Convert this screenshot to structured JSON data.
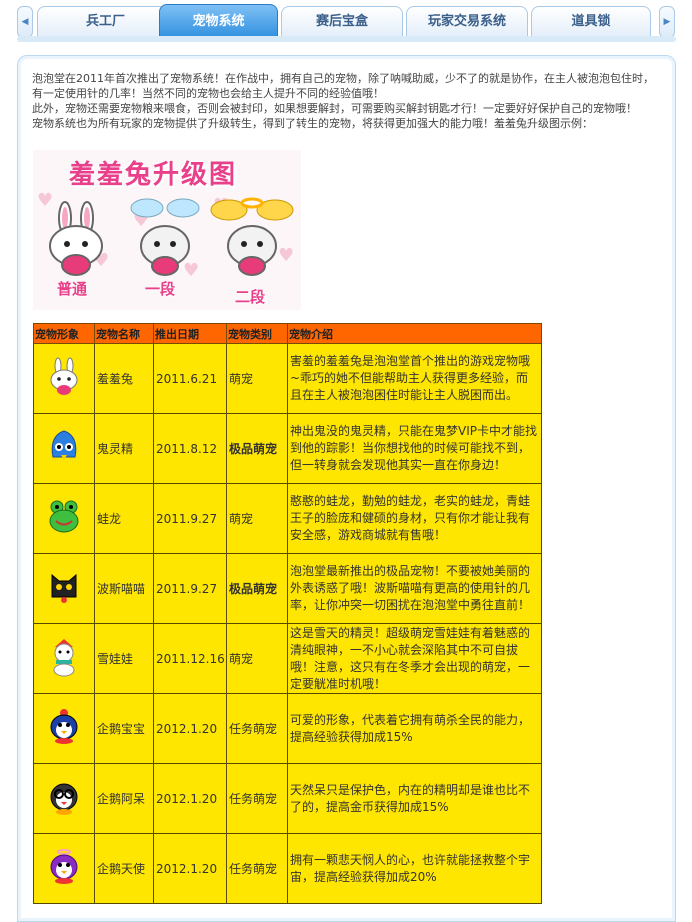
{
  "tabs": [
    {
      "label": "兵工厂"
    },
    {
      "label": "宠物系统"
    },
    {
      "label": "赛后宝盒"
    },
    {
      "label": "玩家交易系统"
    },
    {
      "label": "道具锁"
    }
  ],
  "intro": {
    "p1": "泡泡堂在2011年首次推出了宠物系统！在作战中，拥有自己的宠物，除了呐喊助威，少不了的就是协作，在主人被泡泡包住时，有一定使用针的几率！当然不同的宠物也会给主人提升不同的经验值哦！",
    "p2": "此外，宠物还需要宠物粮来喂食，否则会被封印，如果想要解封，可需要购买解封钥匙才行！一定要好好保护自己的宠物哦！",
    "p3": "宠物系统也为所有玩家的宠物提供了升级转生，得到了转生的宠物，将获得更加强大的能力哦！羞羞兔升级图示例："
  },
  "banner": {
    "title": "羞羞兔升级图",
    "stages": [
      "普通",
      "一段",
      "二段"
    ]
  },
  "table": {
    "headers": [
      "宠物形象",
      "宠物名称",
      "推出日期",
      "宠物类别",
      "宠物介绍"
    ],
    "rows": [
      {
        "icon": "pink-rabbit-icon",
        "name": "羞羞兔",
        "date": "2011.6.21",
        "type": "萌宠",
        "rare": false,
        "desc": "害羞的羞羞兔是泡泡堂首个推出的游戏宠物哦~乖巧的她不但能帮助主人获得更多经验，而且在主人被泡泡困住时能让主人脱困而出。"
      },
      {
        "icon": "blue-ghost-icon",
        "name": "鬼灵精",
        "date": "2011.8.12",
        "type": "极品萌宠",
        "rare": true,
        "desc": "神出鬼没的鬼灵精，只能在鬼梦VIP卡中才能找到他的踪影！当你想找他的时候可能找不到，但一转身就会发现他其实一直在你身边！"
      },
      {
        "icon": "green-frog-icon",
        "name": "蛙龙",
        "date": "2011.9.27",
        "type": "萌宠",
        "rare": false,
        "desc": "憨憨的蛙龙，勤勉的蛙龙，老实的蛙龙，青蛙王子的脸庞和健硕的身材，只有你才能让我有安全感，游戏商城就有售哦！"
      },
      {
        "icon": "black-cat-icon",
        "name": "波斯喵喵",
        "date": "2011.9.27",
        "type": "极品萌宠",
        "rare": true,
        "desc": "泡泡堂最新推出的极品宠物！不要被她美丽的外表诱惑了哦！波斯喵喵有更高的使用针的几率，让你冲突一切困扰在泡泡堂中勇往直前！"
      },
      {
        "icon": "snowman-icon",
        "name": "雪娃娃",
        "date": "2011.12.16",
        "type": "萌宠",
        "rare": false,
        "desc": "这是雪天的精灵！超级萌宠雪娃娃有着魅惑的清纯眼神，一不小心就会深陷其中不可自拔哦！注意，这只有在冬季才会出现的萌宠，一定要觥准时机哦！"
      },
      {
        "icon": "penguin-baby-icon",
        "name": "企鹅宝宝",
        "date": "2012.1.20",
        "type": "任务萌宠",
        "rare": false,
        "desc": "可爱的形象，代表着它拥有萌杀全民的能力，提高经验获得加成15%"
      },
      {
        "icon": "penguin-dull-icon",
        "name": "企鹅阿呆",
        "date": "2012.1.20",
        "type": "任务萌宠",
        "rare": false,
        "desc": "天然呆只是保护色，内在的精明却是谁也比不了的，提高金币获得加成15%"
      },
      {
        "icon": "penguin-angel-icon",
        "name": "企鹅天使",
        "date": "2012.1.20",
        "type": "任务萌宠",
        "rare": false,
        "desc": "拥有一颗悲天悯人的心，也许就能拯救整个宇宙，提高经验获得加成20%"
      }
    ]
  }
}
